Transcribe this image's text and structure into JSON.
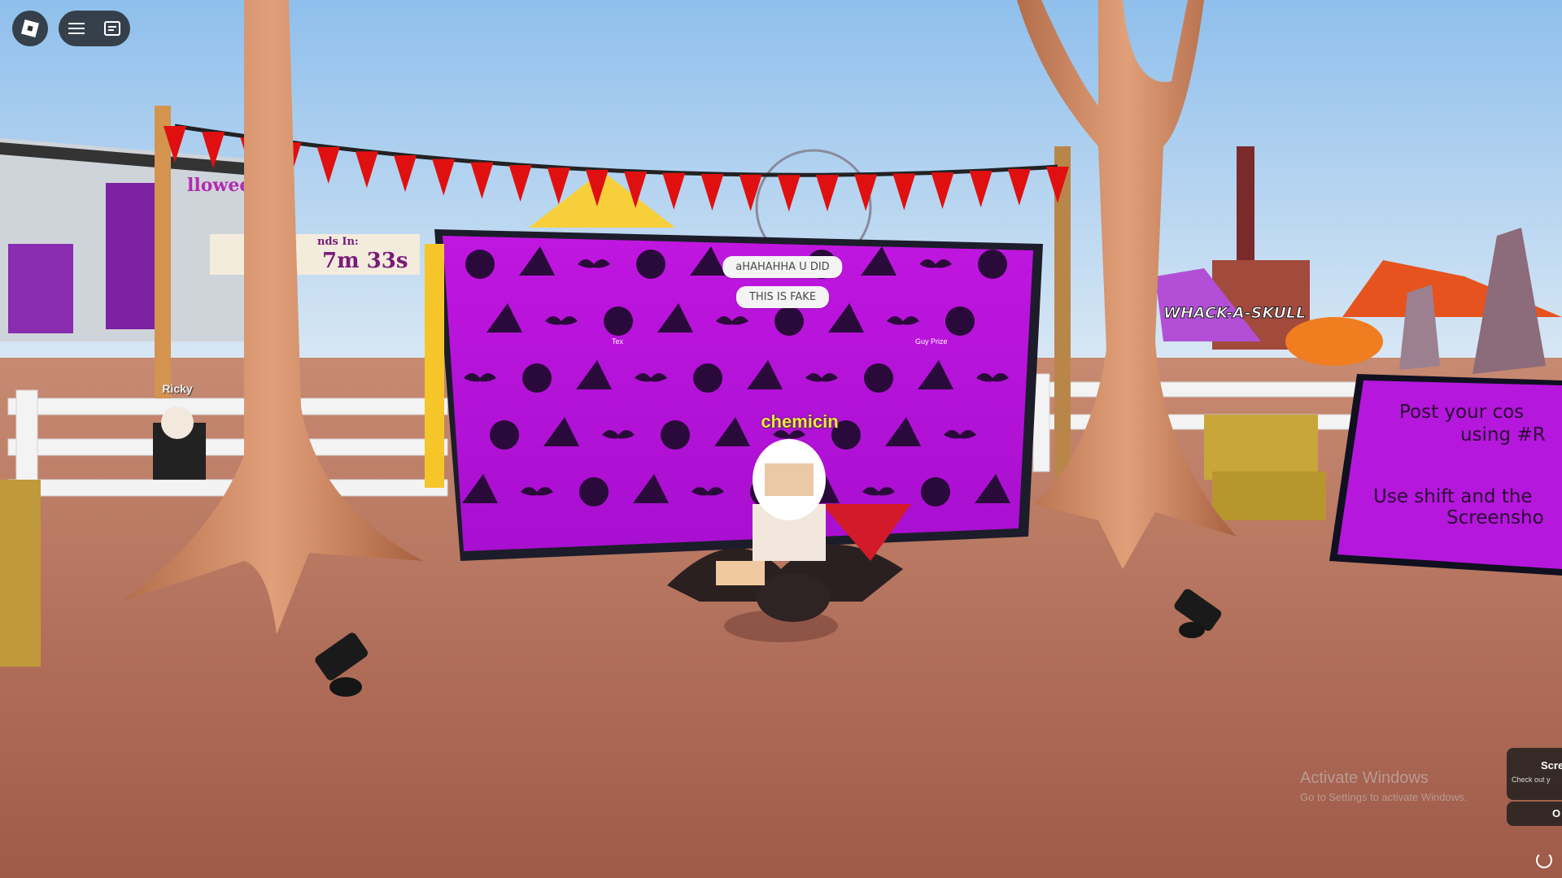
{
  "topbar": {
    "roblox_icon": "roblox-logo-icon",
    "menu_icon": "hamburger-menu-icon",
    "chat_icon": "chat-icon"
  },
  "world": {
    "player_name": "chemicin",
    "chat_bubbles": [
      "aHAHAHHA U DID",
      "THIS IS FAKE"
    ],
    "npc_name": "Ricky",
    "timer_label": "nds In:",
    "timer_value": "7m 33s",
    "building_sign": "lloween",
    "booth_sign": "WHACK-A-SKULL",
    "prize_labels": [
      "Tex",
      "Guy Prize"
    ],
    "info_panel_line1": "Post your cos",
    "info_panel_line2": "using #R",
    "info_panel_line3": "Use shift and the",
    "info_panel_line4": "Screensho"
  },
  "overlay": {
    "activate_title": "Activate Windows",
    "activate_sub": "Go to Settings to activate Windows.",
    "toast_title": "Scre",
    "toast_sub": "Check out y",
    "toast_btn": "O"
  },
  "colors": {
    "sky_top": "#9cc6ec",
    "sky_bottom": "#e3eef6",
    "ground": "#b5705a",
    "backdrop_purple": "#b512d8",
    "pennant_red": "#e01010",
    "nametag_yellow": "#f7e04b"
  }
}
